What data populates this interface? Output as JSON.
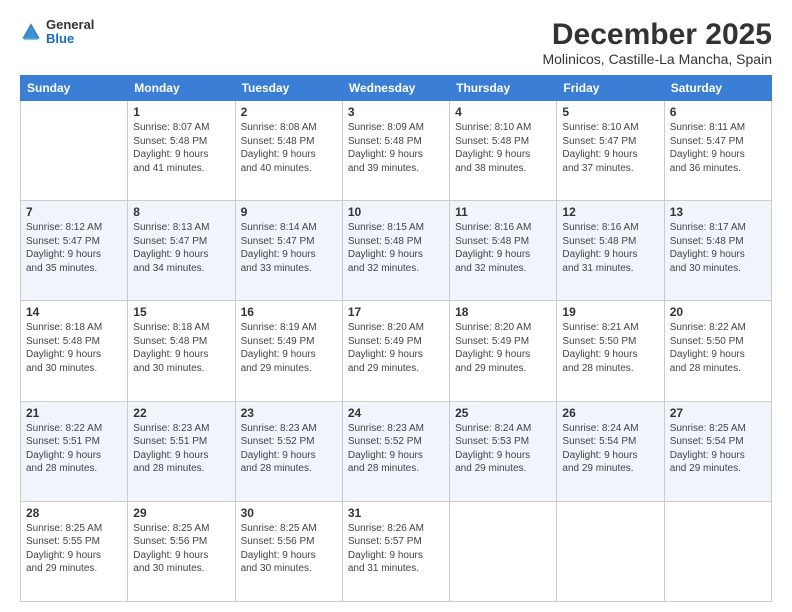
{
  "header": {
    "logo_general": "General",
    "logo_blue": "Blue",
    "title": "December 2025",
    "subtitle": "Molinicos, Castille-La Mancha, Spain"
  },
  "days_of_week": [
    "Sunday",
    "Monday",
    "Tuesday",
    "Wednesday",
    "Thursday",
    "Friday",
    "Saturday"
  ],
  "weeks": [
    [
      {
        "day": "",
        "info": ""
      },
      {
        "day": "1",
        "info": "Sunrise: 8:07 AM\nSunset: 5:48 PM\nDaylight: 9 hours\nand 41 minutes."
      },
      {
        "day": "2",
        "info": "Sunrise: 8:08 AM\nSunset: 5:48 PM\nDaylight: 9 hours\nand 40 minutes."
      },
      {
        "day": "3",
        "info": "Sunrise: 8:09 AM\nSunset: 5:48 PM\nDaylight: 9 hours\nand 39 minutes."
      },
      {
        "day": "4",
        "info": "Sunrise: 8:10 AM\nSunset: 5:48 PM\nDaylight: 9 hours\nand 38 minutes."
      },
      {
        "day": "5",
        "info": "Sunrise: 8:10 AM\nSunset: 5:47 PM\nDaylight: 9 hours\nand 37 minutes."
      },
      {
        "day": "6",
        "info": "Sunrise: 8:11 AM\nSunset: 5:47 PM\nDaylight: 9 hours\nand 36 minutes."
      }
    ],
    [
      {
        "day": "7",
        "info": "Sunrise: 8:12 AM\nSunset: 5:47 PM\nDaylight: 9 hours\nand 35 minutes."
      },
      {
        "day": "8",
        "info": "Sunrise: 8:13 AM\nSunset: 5:47 PM\nDaylight: 9 hours\nand 34 minutes."
      },
      {
        "day": "9",
        "info": "Sunrise: 8:14 AM\nSunset: 5:47 PM\nDaylight: 9 hours\nand 33 minutes."
      },
      {
        "day": "10",
        "info": "Sunrise: 8:15 AM\nSunset: 5:48 PM\nDaylight: 9 hours\nand 32 minutes."
      },
      {
        "day": "11",
        "info": "Sunrise: 8:16 AM\nSunset: 5:48 PM\nDaylight: 9 hours\nand 32 minutes."
      },
      {
        "day": "12",
        "info": "Sunrise: 8:16 AM\nSunset: 5:48 PM\nDaylight: 9 hours\nand 31 minutes."
      },
      {
        "day": "13",
        "info": "Sunrise: 8:17 AM\nSunset: 5:48 PM\nDaylight: 9 hours\nand 30 minutes."
      }
    ],
    [
      {
        "day": "14",
        "info": "Sunrise: 8:18 AM\nSunset: 5:48 PM\nDaylight: 9 hours\nand 30 minutes."
      },
      {
        "day": "15",
        "info": "Sunrise: 8:18 AM\nSunset: 5:48 PM\nDaylight: 9 hours\nand 30 minutes."
      },
      {
        "day": "16",
        "info": "Sunrise: 8:19 AM\nSunset: 5:49 PM\nDaylight: 9 hours\nand 29 minutes."
      },
      {
        "day": "17",
        "info": "Sunrise: 8:20 AM\nSunset: 5:49 PM\nDaylight: 9 hours\nand 29 minutes."
      },
      {
        "day": "18",
        "info": "Sunrise: 8:20 AM\nSunset: 5:49 PM\nDaylight: 9 hours\nand 29 minutes."
      },
      {
        "day": "19",
        "info": "Sunrise: 8:21 AM\nSunset: 5:50 PM\nDaylight: 9 hours\nand 28 minutes."
      },
      {
        "day": "20",
        "info": "Sunrise: 8:22 AM\nSunset: 5:50 PM\nDaylight: 9 hours\nand 28 minutes."
      }
    ],
    [
      {
        "day": "21",
        "info": "Sunrise: 8:22 AM\nSunset: 5:51 PM\nDaylight: 9 hours\nand 28 minutes."
      },
      {
        "day": "22",
        "info": "Sunrise: 8:23 AM\nSunset: 5:51 PM\nDaylight: 9 hours\nand 28 minutes."
      },
      {
        "day": "23",
        "info": "Sunrise: 8:23 AM\nSunset: 5:52 PM\nDaylight: 9 hours\nand 28 minutes."
      },
      {
        "day": "24",
        "info": "Sunrise: 8:23 AM\nSunset: 5:52 PM\nDaylight: 9 hours\nand 28 minutes."
      },
      {
        "day": "25",
        "info": "Sunrise: 8:24 AM\nSunset: 5:53 PM\nDaylight: 9 hours\nand 29 minutes."
      },
      {
        "day": "26",
        "info": "Sunrise: 8:24 AM\nSunset: 5:54 PM\nDaylight: 9 hours\nand 29 minutes."
      },
      {
        "day": "27",
        "info": "Sunrise: 8:25 AM\nSunset: 5:54 PM\nDaylight: 9 hours\nand 29 minutes."
      }
    ],
    [
      {
        "day": "28",
        "info": "Sunrise: 8:25 AM\nSunset: 5:55 PM\nDaylight: 9 hours\nand 29 minutes."
      },
      {
        "day": "29",
        "info": "Sunrise: 8:25 AM\nSunset: 5:56 PM\nDaylight: 9 hours\nand 30 minutes."
      },
      {
        "day": "30",
        "info": "Sunrise: 8:25 AM\nSunset: 5:56 PM\nDaylight: 9 hours\nand 30 minutes."
      },
      {
        "day": "31",
        "info": "Sunrise: 8:26 AM\nSunset: 5:57 PM\nDaylight: 9 hours\nand 31 minutes."
      },
      {
        "day": "",
        "info": ""
      },
      {
        "day": "",
        "info": ""
      },
      {
        "day": "",
        "info": ""
      }
    ]
  ]
}
